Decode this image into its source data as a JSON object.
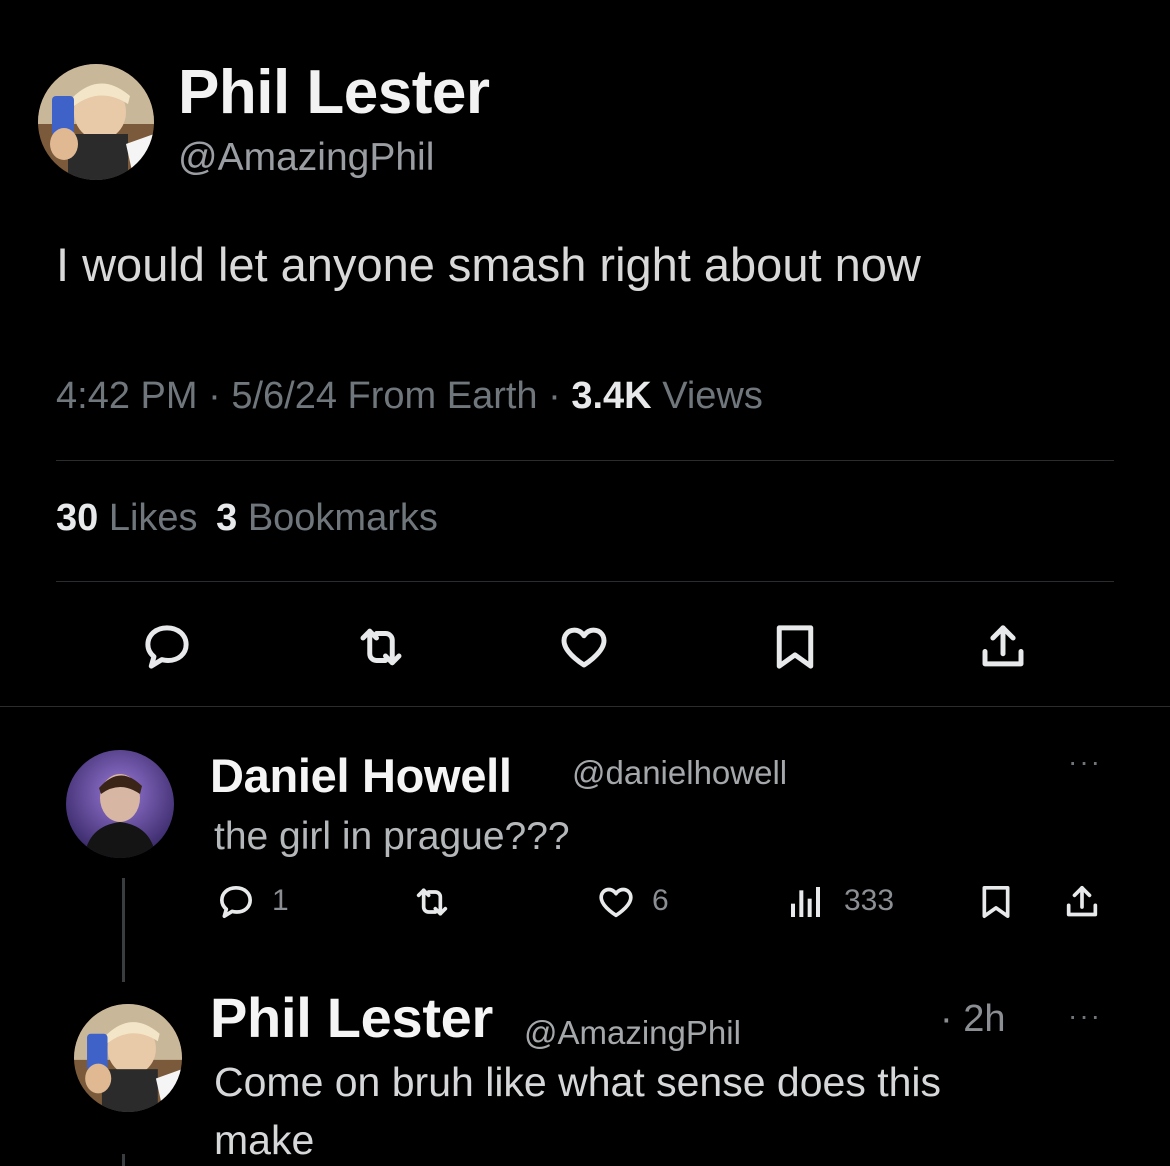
{
  "main_tweet": {
    "author_name": "Phil Lester",
    "author_handle": "@AmazingPhil",
    "text": "I would let anyone smash right about now",
    "time": "4:42 PM",
    "sep1": " · ",
    "date": "5/6/24",
    "source": " From Earth",
    "sep2": " · ",
    "views_count": "3.4K",
    "views_label": " Views",
    "likes_count": "30",
    "likes_label": " Likes",
    "bookmarks_count": "3",
    "bookmarks_label": " Bookmarks",
    "actions": [
      "reply-icon",
      "retweet-icon",
      "like-icon",
      "bookmark-icon",
      "share-icon"
    ]
  },
  "replies": [
    {
      "author_name": "Daniel Howell",
      "author_handle": "@danielhowell",
      "text": "the girl in prague???",
      "more_label": "···",
      "reply_count": "1",
      "like_count": "6",
      "view_count": "333"
    },
    {
      "author_name": "Phil Lester",
      "author_handle": "@AmazingPhil",
      "time": "· 2h",
      "more_label": "···",
      "text_line1": "Come on bruh like what sense does this",
      "text_line2": "make"
    }
  ],
  "colors": {
    "background": "#000000",
    "text_primary": "#e7e9ea",
    "text_secondary": "#6f767c",
    "divider": "#2a2d30"
  }
}
